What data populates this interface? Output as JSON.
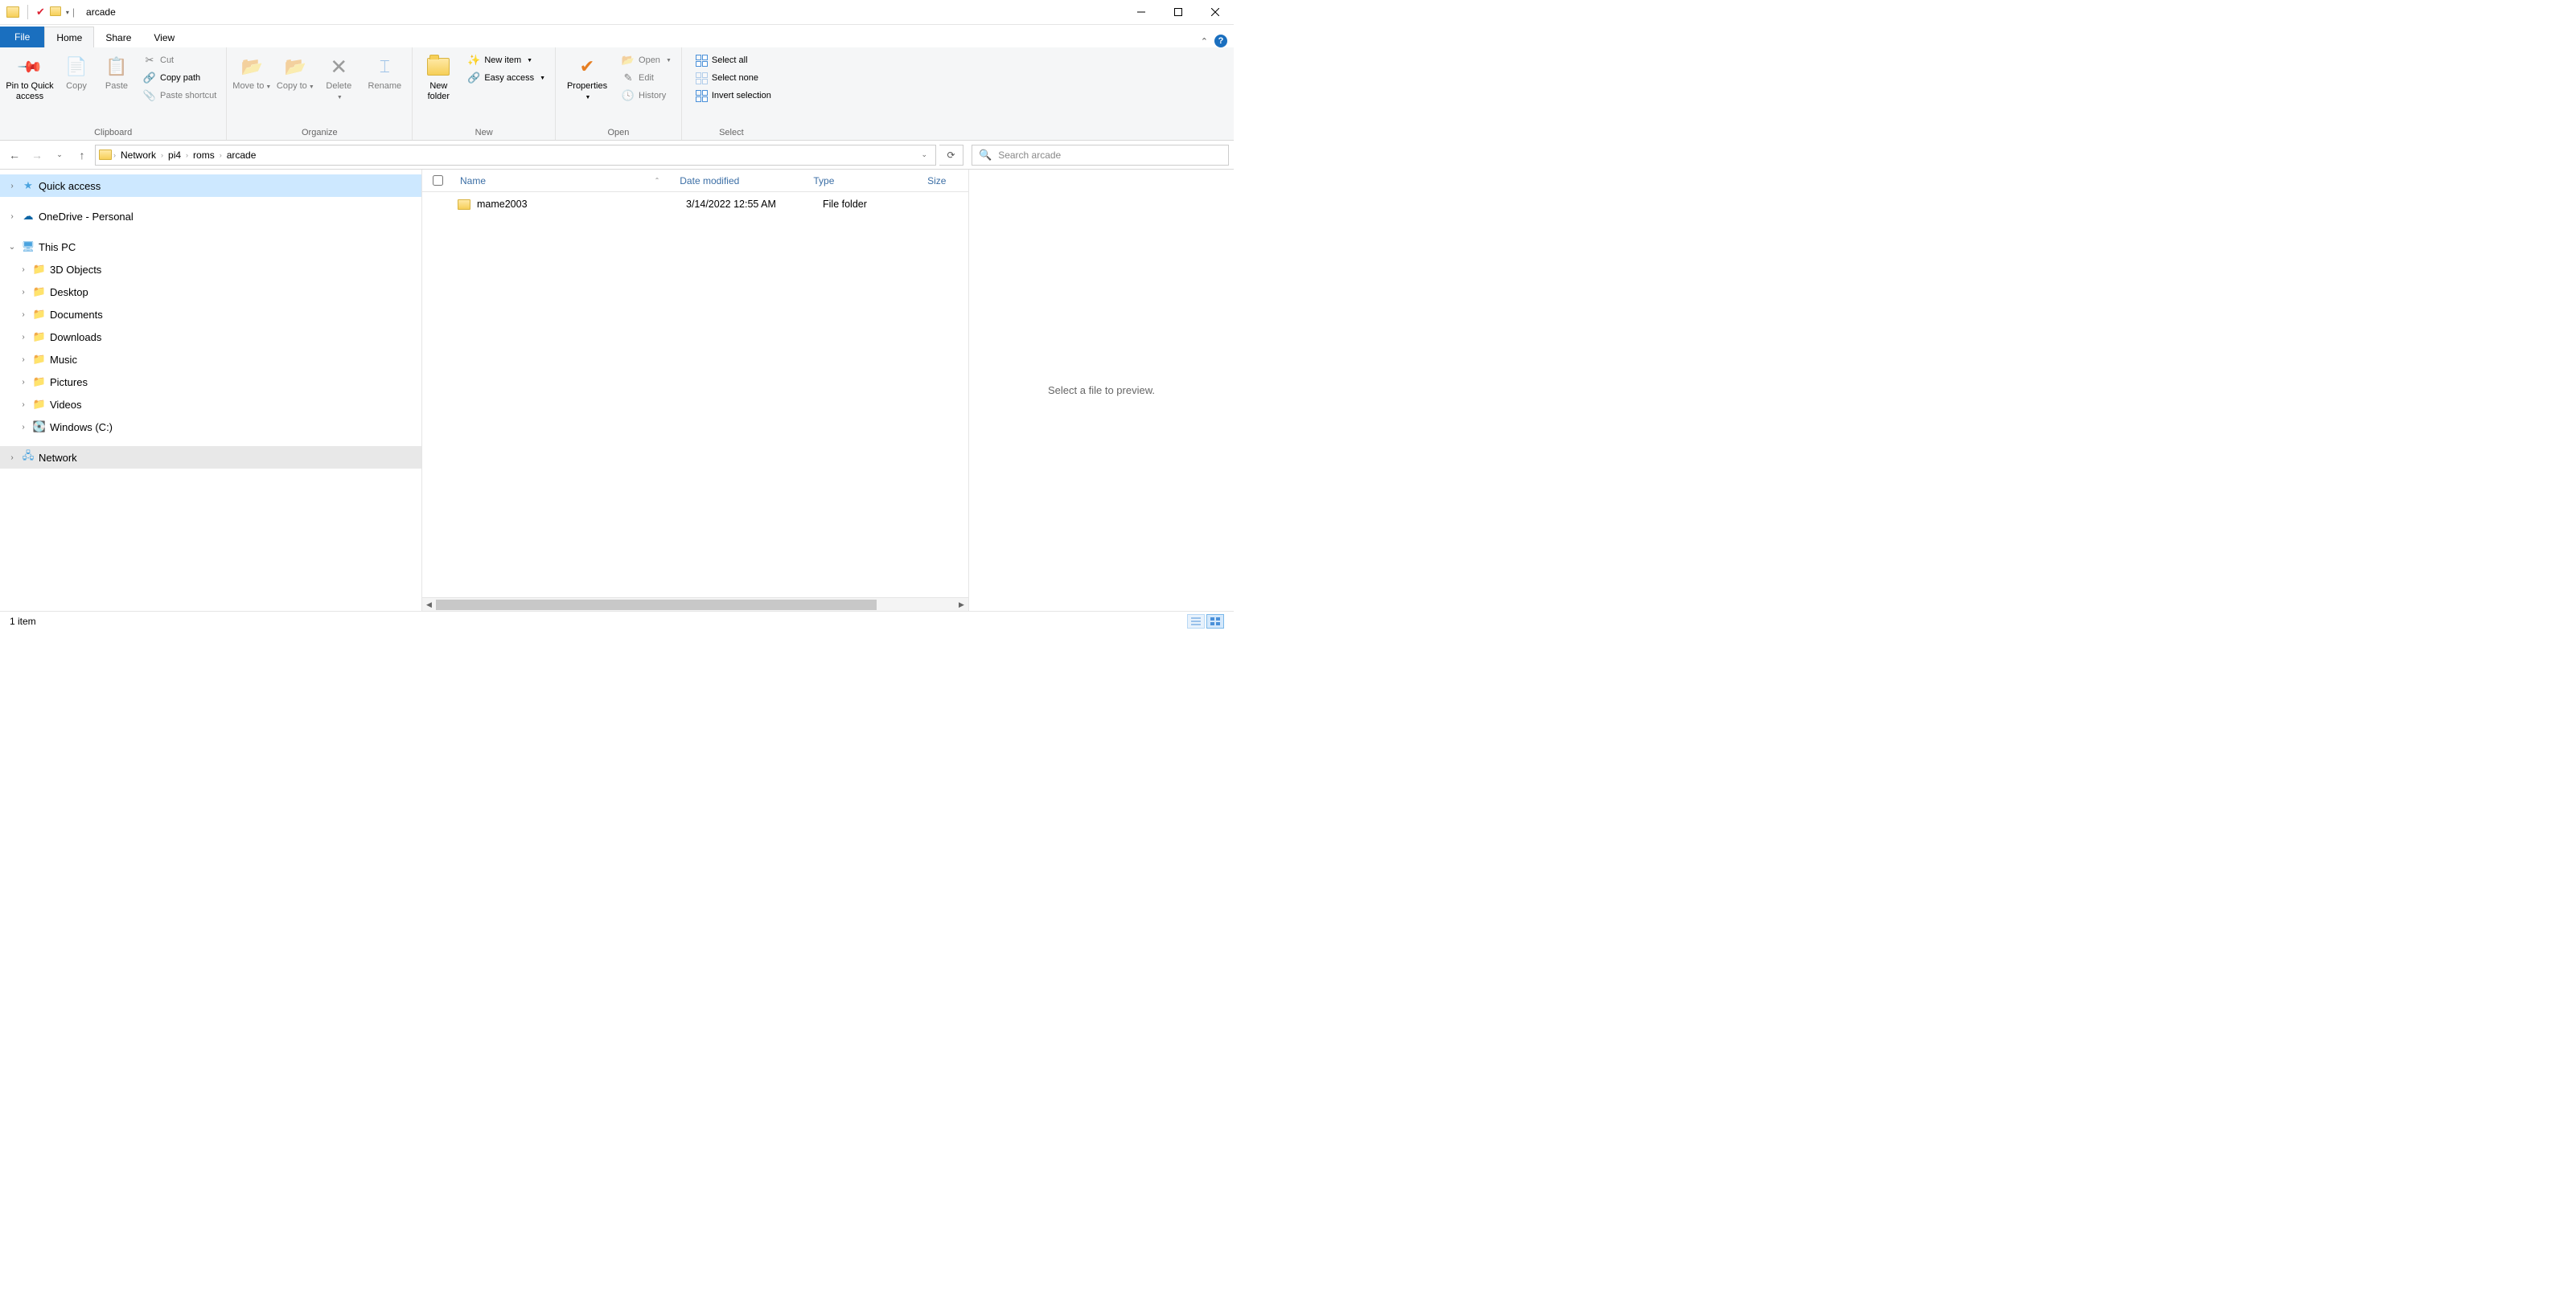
{
  "title": "arcade",
  "tabs": {
    "file": "File",
    "home": "Home",
    "share": "Share",
    "view": "View"
  },
  "ribbon": {
    "clipboard": {
      "label": "Clipboard",
      "pin": "Pin to Quick access",
      "copy": "Copy",
      "paste": "Paste",
      "cut": "Cut",
      "copypath": "Copy path",
      "pasteshortcut": "Paste shortcut"
    },
    "organize": {
      "label": "Organize",
      "moveto": "Move to",
      "copyto": "Copy to",
      "delete": "Delete",
      "rename": "Rename"
    },
    "new": {
      "label": "New",
      "newfolder": "New folder",
      "newitem": "New item",
      "easyaccess": "Easy access"
    },
    "open": {
      "label": "Open",
      "properties": "Properties",
      "open": "Open",
      "edit": "Edit",
      "history": "History"
    },
    "select": {
      "label": "Select",
      "selectall": "Select all",
      "selectnone": "Select none",
      "invert": "Invert selection"
    }
  },
  "breadcrumb": [
    "Network",
    "pi4",
    "roms",
    "arcade"
  ],
  "search_placeholder": "Search arcade",
  "nav": {
    "quickaccess": "Quick access",
    "onedrive": "OneDrive - Personal",
    "thispc": "This PC",
    "thispc_items": [
      "3D Objects",
      "Desktop",
      "Documents",
      "Downloads",
      "Music",
      "Pictures",
      "Videos",
      "Windows (C:)"
    ],
    "network": "Network"
  },
  "columns": {
    "name": "Name",
    "date": "Date modified",
    "type": "Type",
    "size": "Size"
  },
  "rows": [
    {
      "name": "mame2003",
      "date": "3/14/2022 12:55 AM",
      "type": "File folder"
    }
  ],
  "preview_hint": "Select a file to preview.",
  "status": "1 item"
}
